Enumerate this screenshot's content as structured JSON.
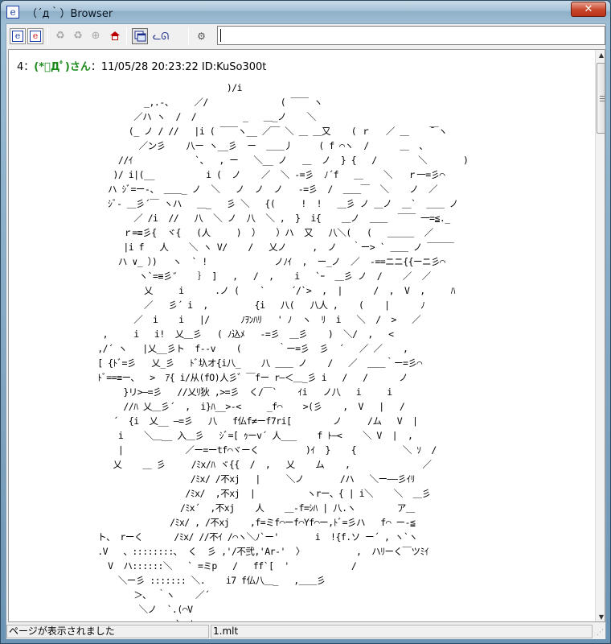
{
  "window": {
    "title": "（´д｀）Browser",
    "close_label": "✕"
  },
  "toolbar": {
    "btn1_icon": "e",
    "btn2_icon": "e",
    "btn3_icon": "♻",
    "btn4_icon": "♻",
    "btn5_icon": "⊕",
    "btn8_icon": "ᓚᘏ",
    "btn9_icon": "⚙",
    "address_value": ""
  },
  "post": {
    "number": "4",
    "separator": "：",
    "name": "(*ﾟДﾟ)さん",
    "date_id": "：11/05/28 20:23:22 ID:KuSo300t",
    "ascii_art": "                                   )/i\n                   _,.-、    ／/              ( ￣￣ ヽ\n                 ／ハ ヽ  /  /         _   ＿_ノ    ＼\n                (_ ノ / //   |i ( ￣￣ヽ__ ／￣ ＼ ＿ ＿又    ( ｒ   ／ ＿    ̄￣ヽ\n                  ／ン彡    八ー ヽ__彡  ー  ＿＿丿     ( f ⌒ヽ  /      ＿  、\n              //ｲ            `、  , ー   ＼__ ノ   ＿  ノ  } {   /        ＼       )\n             )/ i|(__          i (  ノ    ／  ＼ -=彡  ﾉ´f   ＿    ＼   ｒ一=彡⌒\n            ハ ｼﾞ=ー-、 ＿＿_ ノ  ＼   ノ  ノ  ノ   -=彡  /  ＿＿￣  ＼    ノ  ／\n            ｼﾞ- ＿彡´￣ ヽハ   ＿_   彡 ＼   {(     !  !   ＿彡 ノ ＿ノ  ＿`  ＿＿ ノ\n                 ／ /i  //   八  ＼ ノ  八  ＼ ,  }  i{    ＿ノ  ＿＿  ￣￣ 一=≦._\n               ｒ=≡彡{  ヾ{   (人     )  ）   ）ハ  又   八＼(   (   ＿＿＿  ／\n               |i f   人    ＼ ヽ V/    /   乂ノ     ,  ノ   ｀ー> ` ＿＿ ノ ￣￣￣\n              ハ ∨_ ）)   ヽ  ` !             ノﾉｲ  ,  ー_ノ  ／  -==ニニ{{ーニ彡⌒\n                  ヽ`=≡彡″    ｝ ]   ,   /  ,    i   `ｰ  ＿彡 ノ  /    ／  ／\n                   乂     i      .ノ (    `     ´/`>  ,  |      /  ,  V  ,     ﾊ\n                   ／   彡´ i  ,         {i   八(   八人 ,    (    |      ﾉ\n                 ／  i    i   |/      ﾉｦﾝﾊﾘ   ' ﾉ  ヽ  ﾘ  i   ＼  /  >   ／\n           ,     i   i!  乂＿彡   ( ﾉ込ﾒ   -=彡  ＿彡    )  ＼/  ,   <\n          ,/´ ヽ   |乂__彡ト  f--v    (       ｀ー=彡  彡  ´   ／ ／    ,\n          [ {ﾄﾞ=彡   乂_彡   ﾄﾞ圦オ{i八_    八 ＿＿ ノ    /   ／  ＿＿｀ー=彡⌒\n          ﾄﾞ==≡ー、  >  ｱ{ i/从(fO)人彡゛￣fー r―＜＿_彡 i   /   /      ノ\n               }リ>―=彡   //乂ﾘ狄 ,>=彡  く/￣`    ｲi   ノ八   i     i\n               //ﾊ 乂＿彡´  ,  i}ﾊ__>-<     _f⌒    >(彡    ,  V   |   /\n             ´  {i  乂__ ―=彡   八   f仏f≠ーf7ri[        ノ     /ム   V  |\n              i    ＼＿__ 入＿彡   ｼﾞ=[ ｩーv´ 人___    f ﾄ―<    ＼ V  |  ,\n              |            ／ー=ーtf⌒ヾーく         )ｲ  }    {         ＼ ｿ  /\n             乂    ＿ 彡     /ﾐx/ﾊ ヾ{{  /  ,   乂    ム    ,              ／\n                            /ﾐx/ /不xj   |     ＼ノ       /ハ   ＼ー――彡ｲﾘ\n                           /ﾐx/  ,不xj  |          ヽrー、{ | i＼    ＼  ＿彡\n                          /ﾐx´  ,不xj    人    ＿-f=ｼﾊ | 八.ヽ        ア＿\n                        /ﾐx/ , /不xj    ,f=ミf⌒ーf⌒Yf⌒ー,ﾄﾞ=彡ハ   f⌒ ー-≦\n          ト、 rーく      /ﾐx/ //不ｲ /⌒ヽ＼ﾉ`ー'       i  !{f.ソ ー´ , ヽ`ヽ\n          .V   、::::::::､  く  彡 ,'/不弐,'Ar-'  〉          ,  ハﾘーく￣ツﾐｲ\n            V  ハ::::::＼   ` =ミp   /   ff`[  '            /\n              ＼ー彡 ::::::: ＼.    i7 f仏八＿_   ,＿＿彡\n                 ＞､  ｀ヽ    ／´\n                  ＼ノ  `.(⌒V\n                         `ー'"
  },
  "status": {
    "message": "ページが表示されました",
    "file": "1.mlt"
  }
}
